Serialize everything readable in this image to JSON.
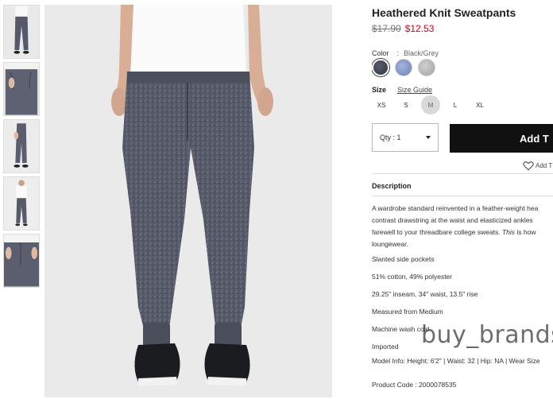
{
  "product": {
    "title": "Heathered Knit Sweatpants",
    "price_old": "$17.90",
    "price_new": "$12.53"
  },
  "color": {
    "label": "Color",
    "separator": ":",
    "value": "Black/Grey",
    "swatches": [
      {
        "name": "black-grey",
        "color": "#3e4350",
        "selected": true
      },
      {
        "name": "blue",
        "color": "#7d93c6",
        "selected": false
      },
      {
        "name": "grey",
        "color": "#b7b7b9",
        "selected": false
      }
    ]
  },
  "size": {
    "label": "Size",
    "guide": "Size Guide",
    "options": [
      "XS",
      "S",
      "M",
      "L",
      "XL"
    ],
    "selected": "M"
  },
  "qty": {
    "label": "Qty : 1"
  },
  "add_button": {
    "label": "Add T"
  },
  "wishlist": {
    "label": "Add T",
    "icon": "heart-icon"
  },
  "description": {
    "heading": "Description",
    "lines": [
      "A wardrobe standard reinvented in a feather-weight hea",
      "contrast drawstring at the waist and elasticized ankles",
      "farewell to your threadbare college sweats. This is how",
      "loungewear."
    ],
    "bullets": [
      "Slanted side pockets",
      "51% cotton, 49% polyester",
      "29.25\" inseam, 34\" waist, 13.5\" rise",
      "Measured from Medium",
      "Machine wash cold",
      "Imported",
      "Model Info: Height: 6'2\" | Waist: 32 | Hip: NA | Wear Size",
      "Product Code : 2000078535"
    ]
  },
  "watermark": "buy_brands",
  "colors": {
    "accent": "#d0021b",
    "button": "#111111"
  }
}
